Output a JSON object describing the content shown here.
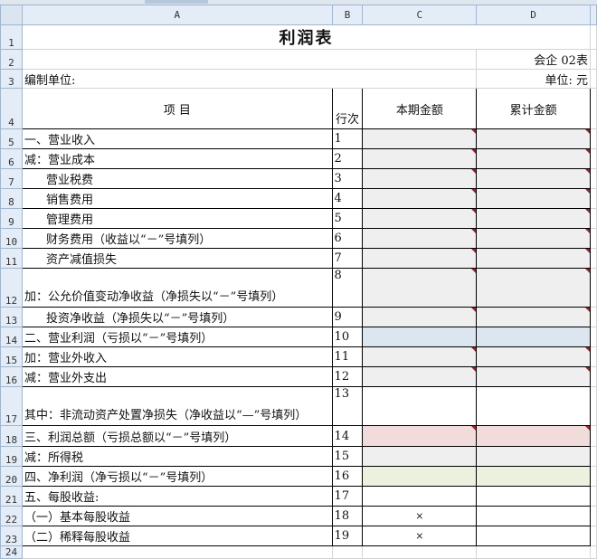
{
  "columns": [
    "A",
    "B",
    "C",
    "D"
  ],
  "row_numbers": [
    "1",
    "2",
    "3",
    "4",
    "5",
    "6",
    "7",
    "8",
    "9",
    "10",
    "11",
    "12",
    "13",
    "14",
    "15",
    "16",
    "17",
    "18",
    "19",
    "20",
    "21",
    "22",
    "23",
    "24"
  ],
  "title": "利润表",
  "form_code": "会企 02表",
  "preparer_label": "编制单位:",
  "unit_label": "单位:  元",
  "headers": {
    "item": "项   目",
    "line_no": "行次",
    "current": "本期金额",
    "cumulative": "累计金额"
  },
  "colors": {
    "gray": "#efefef",
    "blue": "#dce6f1",
    "pink": "#f2dcdb",
    "green": "#ebf1de",
    "white": "#ffffff",
    "comment_marker": "#a0202a"
  },
  "rows": [
    {
      "item": "一、营业收入",
      "no": "1",
      "fill": "gray",
      "current": "",
      "cumulative": ""
    },
    {
      "item": "减：营业成本",
      "no": "2",
      "fill": "gray",
      "current": "",
      "cumulative": ""
    },
    {
      "item": "营业税费",
      "no": "3",
      "fill": "gray",
      "indent": true,
      "current": "",
      "cumulative": ""
    },
    {
      "item": "销售费用",
      "no": "4",
      "fill": "gray",
      "indent": true,
      "current": "",
      "cumulative": ""
    },
    {
      "item": "管理费用",
      "no": "5",
      "fill": "gray",
      "indent": true,
      "current": "",
      "cumulative": ""
    },
    {
      "item": "财务费用（收益以“－”号填列）",
      "no": "6",
      "fill": "gray",
      "indent": true,
      "current": "",
      "cumulative": ""
    },
    {
      "item": "资产减值损失",
      "no": "7",
      "fill": "gray",
      "indent": true,
      "current": "",
      "cumulative": ""
    },
    {
      "item": "加：公允价值变动净收益（净损失以“－”号填列）",
      "no": "8",
      "fill": "gray",
      "current": "",
      "cumulative": ""
    },
    {
      "item": "投资净收益（净损失以“－”号填列）",
      "no": "9",
      "fill": "gray",
      "indent": true,
      "current": "",
      "cumulative": ""
    },
    {
      "item": "二、营业利润（亏损以“－”号填列）",
      "no": "10",
      "fill": "blue",
      "current": "",
      "cumulative": ""
    },
    {
      "item": "加：营业外收入",
      "no": "11",
      "fill": "gray",
      "current": "",
      "cumulative": ""
    },
    {
      "item": "减：营业外支出",
      "no": "12",
      "fill": "gray",
      "current": "",
      "cumulative": ""
    },
    {
      "item": "其中：非流动资产处置净损失（净收益以“—”号填列）",
      "no": "13",
      "fill": "white",
      "current": "",
      "cumulative": ""
    },
    {
      "item": "三、利润总额（亏损总额以“－”号填列）",
      "no": "14",
      "fill": "pink",
      "current": "",
      "cumulative": ""
    },
    {
      "item": "减：所得税",
      "no": "15",
      "fill": "gray",
      "current": "",
      "cumulative": ""
    },
    {
      "item": "四、净利润（净亏损以“－”号填列）",
      "no": "16",
      "fill": "green",
      "current": "",
      "cumulative": ""
    },
    {
      "item": "五、每股收益:",
      "no": "17",
      "fill": "white",
      "current": "",
      "cumulative": ""
    },
    {
      "item": "（一）基本每股收益",
      "no": "18",
      "fill": "white",
      "current": "×",
      "cumulative": ""
    },
    {
      "item": "（二）稀释每股收益",
      "no": "19",
      "fill": "white",
      "current": "×",
      "cumulative": ""
    }
  ]
}
